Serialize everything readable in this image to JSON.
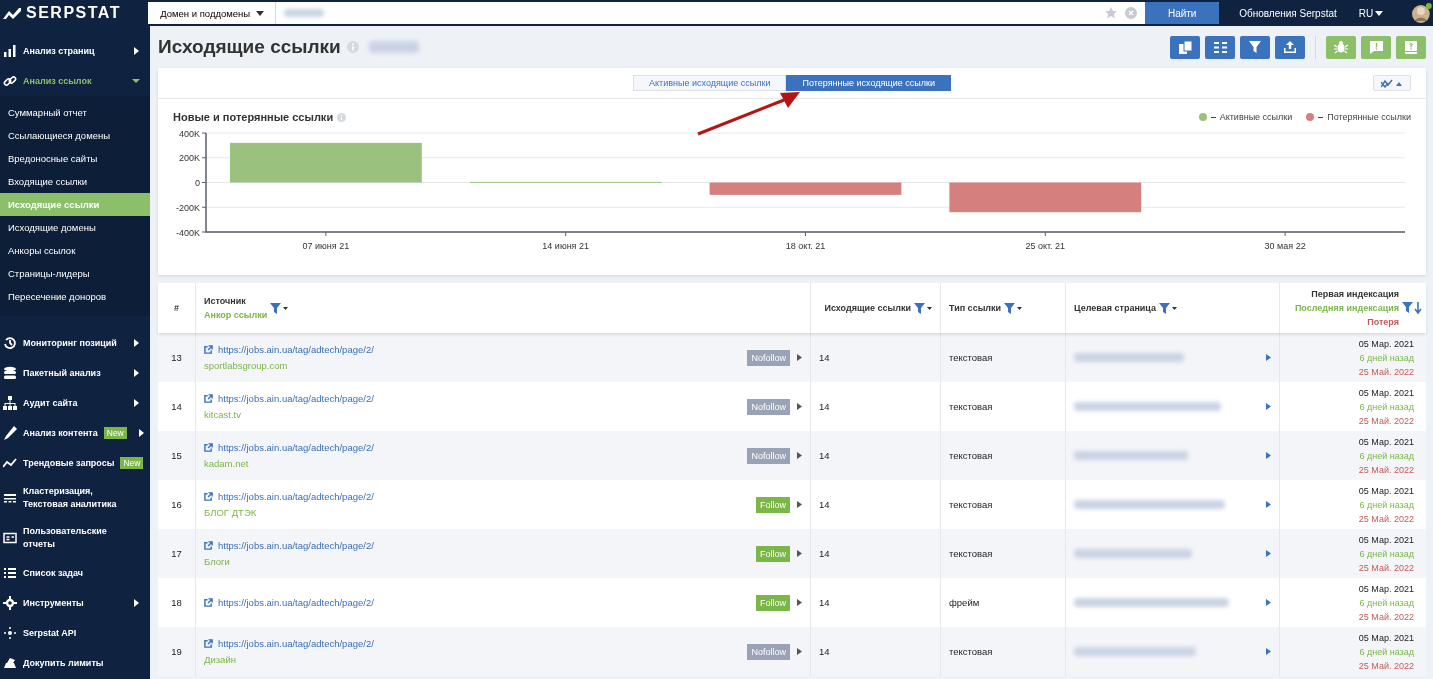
{
  "topbar": {
    "logo": "SERPSTAT",
    "search_scope": "Домен и поддомены",
    "search_button": "Найти",
    "updates_link": "Обновления Serpstat",
    "language": "RU"
  },
  "sidebar": {
    "items": [
      {
        "label": "Анализ страниц",
        "expanded": false
      },
      {
        "label": "Анализ ссылок",
        "expanded": true,
        "children": [
          {
            "label": "Суммарный отчет",
            "selected": false
          },
          {
            "label": "Ссылающиеся домены",
            "selected": false
          },
          {
            "label": "Вредоносные сайты",
            "selected": false
          },
          {
            "label": "Входящие ссылки",
            "selected": false
          },
          {
            "label": "Исходящие ссылки",
            "selected": true
          },
          {
            "label": "Исходящие домены",
            "selected": false
          },
          {
            "label": "Анкоры ссылок",
            "selected": false
          },
          {
            "label": "Страницы-лидеры",
            "selected": false
          },
          {
            "label": "Пересечение доноров",
            "selected": false
          }
        ]
      },
      {
        "label": "Мониторинг позиций",
        "expanded": false
      },
      {
        "label": "Пакетный анализ",
        "expanded": false
      },
      {
        "label": "Аудит сайта",
        "expanded": false
      },
      {
        "label": "Анализ контента",
        "badge": "New",
        "expanded": false
      },
      {
        "label": "Трендовые запросы",
        "badge": "New"
      },
      {
        "label": "Кластеризация, Текстовая аналитика"
      },
      {
        "label": "Пользовательские отчеты"
      },
      {
        "label": "Список задач"
      },
      {
        "label": "Инструменты",
        "expanded": false
      },
      {
        "label": "Serpstat API"
      },
      {
        "label": "Докупить лимиты"
      }
    ]
  },
  "page": {
    "title": "Исходящие ссылки"
  },
  "tabs": [
    {
      "label": "Активные исходящие ссылки",
      "selected": false
    },
    {
      "label": "Потерянные исходящие ссылки",
      "selected": true
    }
  ],
  "chart": {
    "title": "Новые и потерянные ссылки",
    "chart_data": {
      "type": "bar",
      "categories": [
        "07 июня 21",
        "14 июня 21",
        "18 окт. 21",
        "25 окт. 21",
        "30 мая 22"
      ],
      "series": [
        {
          "name": "Активные ссылки",
          "color": "#9bc17e",
          "values": [
            320000,
            5000,
            null,
            null,
            null
          ]
        },
        {
          "name": "Потерянные ссылки",
          "color": "#d5807f",
          "values": [
            null,
            null,
            -100000,
            -240000,
            null
          ]
        }
      ],
      "ylim": [
        -400000,
        400000
      ],
      "grid": true,
      "yticks": [
        {
          "value": 400000,
          "label": "400K"
        },
        {
          "value": 200000,
          "label": "200K"
        },
        {
          "value": 0,
          "label": "0"
        },
        {
          "value": -200000,
          "label": "-200K"
        },
        {
          "value": -400000,
          "label": "-400K"
        }
      ],
      "stacked": true
    }
  },
  "table": {
    "columns": {
      "number": "#",
      "source": "Источник",
      "anchor": "Анкор ссылки",
      "outgoing": "Исходящие ссылки",
      "type": "Тип ссылки",
      "target": "Целевая страница",
      "first_index": "Первая индексация",
      "last_index": "Последняя индексация",
      "lost": "Потеря"
    },
    "rows": [
      {
        "number": "13",
        "url": "https://jobs.ain.ua/tag/adtech/page/2/",
        "anchor": "sportlabsgroup.com",
        "rel": "Nofollow",
        "follow": false,
        "outgoing": "14",
        "type": "текстовая",
        "first": "05 Мар. 2021",
        "last": "6 дней назад",
        "lost": "25 Май. 2022"
      },
      {
        "number": "14",
        "url": "https://jobs.ain.ua/tag/adtech/page/2/",
        "anchor": "kitcast.tv",
        "rel": "Nofollow",
        "follow": false,
        "outgoing": "14",
        "type": "текстовая",
        "first": "05 Мар. 2021",
        "last": "6 дней назад",
        "lost": "25 Май. 2022"
      },
      {
        "number": "15",
        "url": "https://jobs.ain.ua/tag/adtech/page/2/",
        "anchor": "kadam.net",
        "rel": "Nofollow",
        "follow": false,
        "outgoing": "14",
        "type": "текстовая",
        "first": "05 Мар. 2021",
        "last": "6 дней назад",
        "lost": "25 Май. 2022"
      },
      {
        "number": "16",
        "url": "https://jobs.ain.ua/tag/adtech/page/2/",
        "anchor": "БЛОГ ДТЭК",
        "rel": "Follow",
        "follow": true,
        "outgoing": "14",
        "type": "текстовая",
        "first": "05 Мар. 2021",
        "last": "6 дней назад",
        "lost": "25 Май. 2022"
      },
      {
        "number": "17",
        "url": "https://jobs.ain.ua/tag/adtech/page/2/",
        "anchor": "Блоги",
        "rel": "Follow",
        "follow": true,
        "outgoing": "14",
        "type": "текстовая",
        "first": "05 Мар. 2021",
        "last": "6 дней назад",
        "lost": "25 Май. 2022"
      },
      {
        "number": "18",
        "url": "https://jobs.ain.ua/tag/adtech/page/2/",
        "rel": "Follow",
        "follow": true,
        "outgoing": "14",
        "type": "фрейм",
        "first": "05 Мар. 2021",
        "last": "6 дней назад",
        "lost": "25 Май. 2022"
      },
      {
        "number": "19",
        "url": "https://jobs.ain.ua/tag/adtech/page/2/",
        "anchor": "Дизайн",
        "rel": "Nofollow",
        "follow": false,
        "outgoing": "14",
        "type": "текстовая",
        "first": "05 Мар. 2021",
        "last": "6 дней назад",
        "lost": "25 Май. 2022"
      }
    ]
  }
}
